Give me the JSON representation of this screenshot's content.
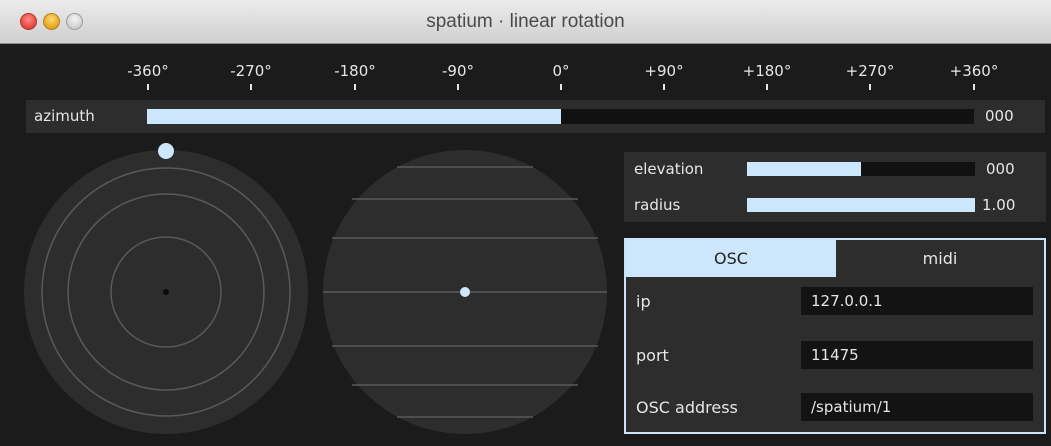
{
  "window": {
    "title": "spatium · linear rotation",
    "buttons": [
      "close",
      "minimize",
      "zoom"
    ]
  },
  "scale": {
    "ticks": [
      "-360°",
      "-270°",
      "-180°",
      "-90°",
      "0°",
      "+90°",
      "+180°",
      "+270°",
      "+360°"
    ]
  },
  "azimuth": {
    "label": "azimuth",
    "value": "000",
    "fill_fraction": 0.5
  },
  "elevation": {
    "label": "elevation",
    "value": "000",
    "fill_fraction": 0.5
  },
  "radius": {
    "label": "radius",
    "value": "1.00",
    "fill_fraction": 1.0
  },
  "tabs": [
    {
      "label": "OSC",
      "active": true
    },
    {
      "label": "midi",
      "active": false
    }
  ],
  "osc": {
    "fields": [
      {
        "label": "ip",
        "value": "127.0.0.1"
      },
      {
        "label": "port",
        "value": "11475"
      },
      {
        "label": "OSC address",
        "value": "/spatium/1"
      }
    ]
  },
  "colors": {
    "accent": "#cce6fb",
    "background": "#1b1b1b",
    "panel": "#2d2d2d",
    "track": "#111111"
  }
}
